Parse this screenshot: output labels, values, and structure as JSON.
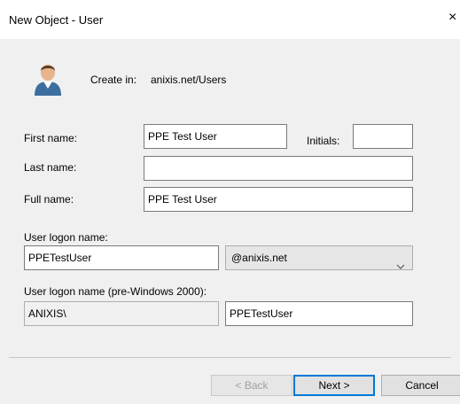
{
  "window": {
    "title": "New Object - User",
    "close_glyph": "×"
  },
  "header": {
    "create_in_label": "Create in:",
    "create_in_value": "anixis.net/Users",
    "icon": "user-icon"
  },
  "form": {
    "first_name_label": "First name:",
    "first_name_value": "PPE Test User",
    "initials_label": "Initials:",
    "initials_value": "",
    "last_name_label": "Last name:",
    "last_name_value": "",
    "full_name_label": "Full name:",
    "full_name_value": "PPE Test User",
    "logon_name_label": "User logon name:",
    "logon_name_value": "PPETestUser",
    "domain_value": "@anixis.net",
    "pre2000_label": "User logon name (pre-Windows 2000):",
    "pre2000_domain_value": "ANIXIS\\",
    "pre2000_name_value": "PPETestUser"
  },
  "buttons": {
    "back": "< Back",
    "next": "Next >",
    "cancel": "Cancel"
  }
}
